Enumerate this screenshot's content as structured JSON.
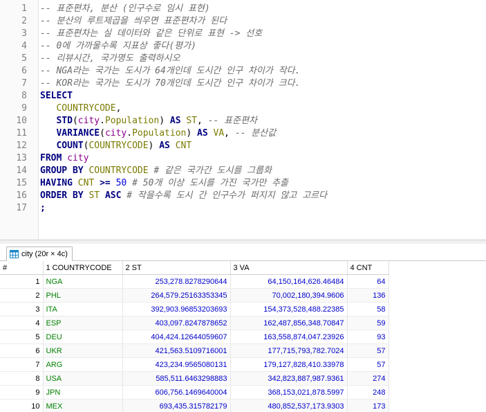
{
  "editor": {
    "line_numbers": [
      "1",
      "2",
      "3",
      "4",
      "5",
      "6",
      "7",
      "8",
      "9",
      "10",
      "11",
      "12",
      "13",
      "14",
      "15",
      "16",
      "17"
    ],
    "lines": [
      [
        {
          "t": "-- 표준편차, 분산 (인구수로 임시 표현)",
          "c": "cm"
        }
      ],
      [
        {
          "t": "-- 분산의 루트제곱을 씌우면 표준편차가 된다",
          "c": "cm"
        }
      ],
      [
        {
          "t": "-- 표준편차는 실 데이터와 같은 단위로 표현 -> 선호",
          "c": "cm"
        }
      ],
      [
        {
          "t": "-- 0에 가까울수록 지표상 좋다(평가)",
          "c": "cm"
        }
      ],
      [
        {
          "t": "-- 리뷰시간, 국가명도 출력하시오",
          "c": "cm"
        }
      ],
      [
        {
          "t": "-- NGA라는 국가는 도시가 64개인데 도시간 인구 차이가 작다.",
          "c": "cm"
        }
      ],
      [
        {
          "t": "-- KOR라는 국가는 도시가 70개인데 도시간 인구 차이가 크다.",
          "c": "cm"
        }
      ],
      [
        {
          "t": "SELECT",
          "c": "kw"
        }
      ],
      [
        {
          "t": "   ",
          "c": "op"
        },
        {
          "t": "COUNTRYCODE",
          "c": "id"
        },
        {
          "t": ",",
          "c": "op"
        }
      ],
      [
        {
          "t": "   ",
          "c": "op"
        },
        {
          "t": "STD",
          "c": "kw"
        },
        {
          "t": "(",
          "c": "op"
        },
        {
          "t": "city",
          "c": "tb"
        },
        {
          "t": ".",
          "c": "op"
        },
        {
          "t": "Population",
          "c": "id"
        },
        {
          "t": ") ",
          "c": "op"
        },
        {
          "t": "AS",
          "c": "kw"
        },
        {
          "t": " ",
          "c": "op"
        },
        {
          "t": "ST",
          "c": "id"
        },
        {
          "t": ", ",
          "c": "op"
        },
        {
          "t": "-- 표준편차",
          "c": "cm"
        }
      ],
      [
        {
          "t": "   ",
          "c": "op"
        },
        {
          "t": "VARIANCE",
          "c": "kw"
        },
        {
          "t": "(",
          "c": "op"
        },
        {
          "t": "city",
          "c": "tb"
        },
        {
          "t": ".",
          "c": "op"
        },
        {
          "t": "Population",
          "c": "id"
        },
        {
          "t": ") ",
          "c": "op"
        },
        {
          "t": "AS",
          "c": "kw"
        },
        {
          "t": " ",
          "c": "op"
        },
        {
          "t": "VA",
          "c": "id"
        },
        {
          "t": ", ",
          "c": "op"
        },
        {
          "t": "-- 분산값",
          "c": "cm"
        }
      ],
      [
        {
          "t": "   ",
          "c": "op"
        },
        {
          "t": "COUNT",
          "c": "kw"
        },
        {
          "t": "(",
          "c": "op"
        },
        {
          "t": "COUNTRYCODE",
          "c": "id"
        },
        {
          "t": ") ",
          "c": "op"
        },
        {
          "t": "AS",
          "c": "kw"
        },
        {
          "t": " ",
          "c": "op"
        },
        {
          "t": "CNT",
          "c": "id"
        }
      ],
      [
        {
          "t": "FROM",
          "c": "kw"
        },
        {
          "t": " ",
          "c": "op"
        },
        {
          "t": "city",
          "c": "tb"
        }
      ],
      [
        {
          "t": "GROUP BY",
          "c": "kw"
        },
        {
          "t": " ",
          "c": "op"
        },
        {
          "t": "COUNTRYCODE",
          "c": "id"
        },
        {
          "t": " ",
          "c": "op"
        },
        {
          "t": "# 같은 국가간 도시를 그룹화",
          "c": "cm"
        }
      ],
      [
        {
          "t": "HAVING",
          "c": "kw"
        },
        {
          "t": " ",
          "c": "op"
        },
        {
          "t": "CNT",
          "c": "id"
        },
        {
          "t": " >= ",
          "c": "kw"
        },
        {
          "t": "50",
          "c": "nm"
        },
        {
          "t": " ",
          "c": "op"
        },
        {
          "t": "# 50개 이상 도시를 가진 국가만 추출",
          "c": "cm"
        }
      ],
      [
        {
          "t": "ORDER BY",
          "c": "kw"
        },
        {
          "t": " ",
          "c": "op"
        },
        {
          "t": "ST",
          "c": "id"
        },
        {
          "t": " ",
          "c": "op"
        },
        {
          "t": "ASC",
          "c": "kw"
        },
        {
          "t": " ",
          "c": "op"
        },
        {
          "t": "# 작을수록 도시 간 인구수가 퍼지지 않고 고르다",
          "c": "cm"
        }
      ],
      [
        {
          "t": ";",
          "c": "kw"
        }
      ]
    ]
  },
  "result_tab": {
    "label": "city (20r × 4c)"
  },
  "grid": {
    "row_header": "#",
    "columns": [
      "1 COUNTRYCODE",
      "2 ST",
      "3 VA",
      "4 CNT"
    ],
    "rows": [
      [
        "1",
        "NGA",
        "253,278.8278290644",
        "64,150,164,626.46484",
        "64"
      ],
      [
        "2",
        "PHL",
        "264,579.25163353345",
        "70,002,180,394.9606",
        "136"
      ],
      [
        "3",
        "ITA",
        "392,903.96853203693",
        "154,373,528,488.22385",
        "58"
      ],
      [
        "4",
        "ESP",
        "403,097.8247878652",
        "162,487,856,348.70847",
        "59"
      ],
      [
        "5",
        "DEU",
        "404,424.12644059607",
        "163,558,874,047.23926",
        "93"
      ],
      [
        "6",
        "UKR",
        "421,563.5109716001",
        "177,715,793,782.7024",
        "57"
      ],
      [
        "7",
        "ARG",
        "423,234.9565080131",
        "179,127,828,410.33978",
        "57"
      ],
      [
        "8",
        "USA",
        "585,511.6463298883",
        "342,823,887,987.9361",
        "274"
      ],
      [
        "9",
        "JPN",
        "606,756.1469640004",
        "368,153,021,878.5997",
        "248"
      ],
      [
        "10",
        "MEX",
        "693,435.315782179",
        "480,852,537,173.9303",
        "173"
      ]
    ]
  }
}
